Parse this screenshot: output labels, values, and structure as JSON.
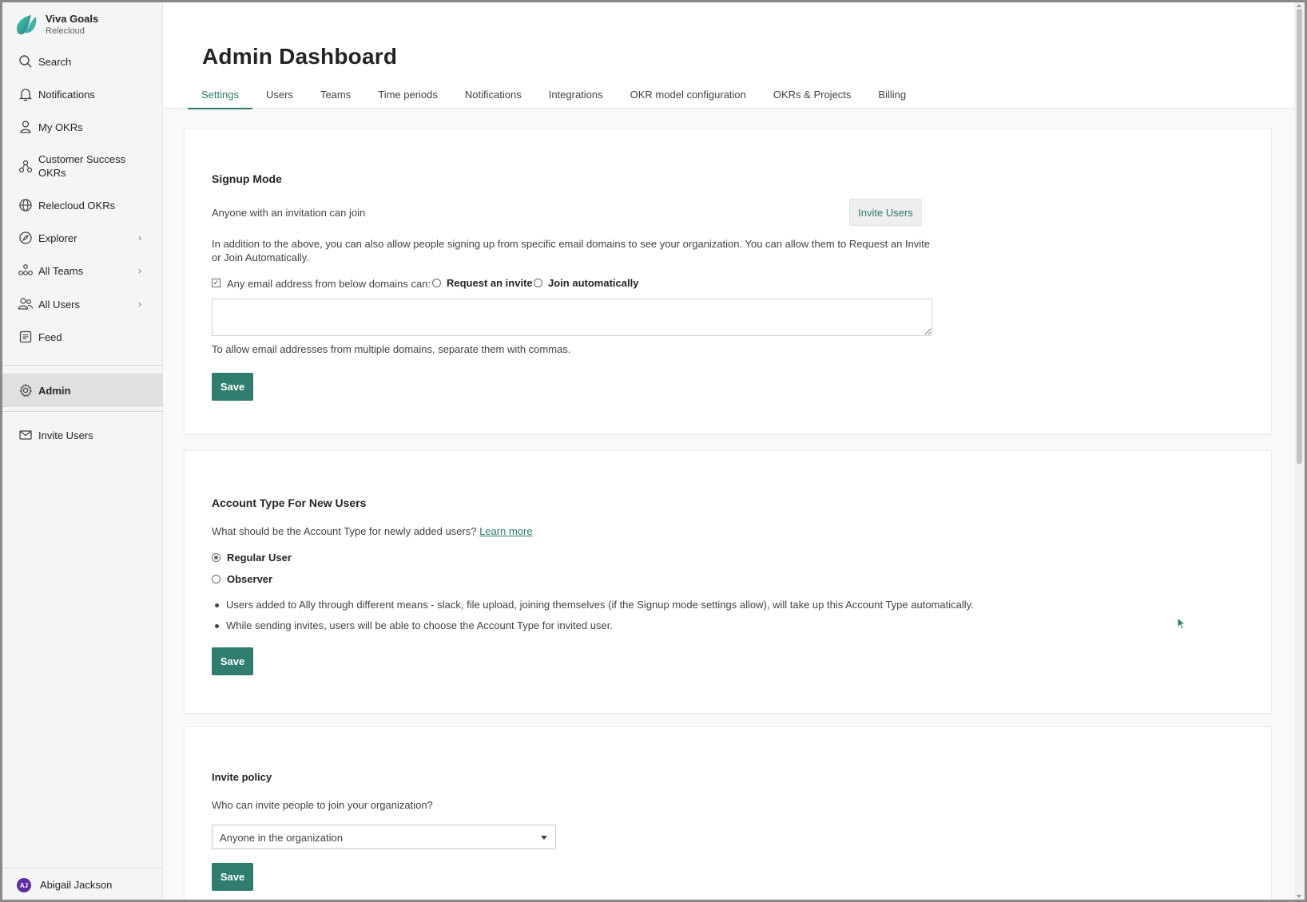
{
  "brand": {
    "name": "Viva Goals",
    "org": "Relecloud"
  },
  "sidebar": {
    "items": [
      {
        "label": "Search",
        "icon": "search-icon"
      },
      {
        "label": "Notifications",
        "icon": "bell-icon"
      },
      {
        "label": "My OKRs",
        "icon": "person-icon"
      },
      {
        "label": "Customer Success",
        "label2": "OKRs",
        "icon": "team-icon"
      },
      {
        "label": "Relecloud OKRs",
        "icon": "globe-icon"
      },
      {
        "label": "Explorer",
        "icon": "compass-icon",
        "chevron": "›"
      },
      {
        "label": "All Teams",
        "icon": "teams-icon",
        "chevron": "›"
      },
      {
        "label": "All Users",
        "icon": "users-icon",
        "chevron": "›"
      },
      {
        "label": "Feed",
        "icon": "feed-icon"
      },
      {
        "label": "Admin",
        "icon": "gear-icon"
      },
      {
        "label": "Invite Users",
        "icon": "mail-icon"
      }
    ],
    "active": "Admin",
    "user": {
      "initials": "AJ",
      "name": "Abigail Jackson"
    }
  },
  "header": {
    "title": "Admin Dashboard",
    "tabs": [
      "Settings",
      "Users",
      "Teams",
      "Time periods",
      "Notifications",
      "Integrations",
      "OKR model configuration",
      "OKRs & Projects",
      "Billing"
    ],
    "active_tab": "Settings"
  },
  "signup": {
    "title": "Signup Mode",
    "mode_text": "Anyone with an invitation can join",
    "invite_button": "Invite Users",
    "description": "In addition to the above, you can also allow people signing up from specific email domains to see your organization. You can allow them to Request an Invite or Join Automatically.",
    "checkbox_label": "Any email address from below domains can:",
    "checkbox_checked": true,
    "option_request": "Request an invite",
    "option_join": "Join automatically",
    "domains_value": "",
    "hint": "To allow email addresses from multiple domains, separate them with commas.",
    "save_label": "Save"
  },
  "account_type": {
    "title": "Account Type For New Users",
    "question": "What should be the Account Type for newly added users?",
    "learn_more": "Learn more",
    "option_regular": "Regular User",
    "option_observer": "Observer",
    "selected": "Regular User",
    "bullets": [
      "Users added to Ally through different means - slack, file upload, joining themselves (if the Signup mode settings allow), will take up this Account Type automatically.",
      "While sending invites, users will be able to choose the Account Type for invited user."
    ],
    "save_label": "Save"
  },
  "invite_policy": {
    "title": "Invite policy",
    "question": "Who can invite people to join your organization?",
    "selected_option": "Anyone in the organization",
    "save_label": "Save"
  },
  "colors": {
    "accent": "#2e7d6d",
    "tab_active": "#2b7a6b",
    "avatar": "#5b2ea3"
  }
}
